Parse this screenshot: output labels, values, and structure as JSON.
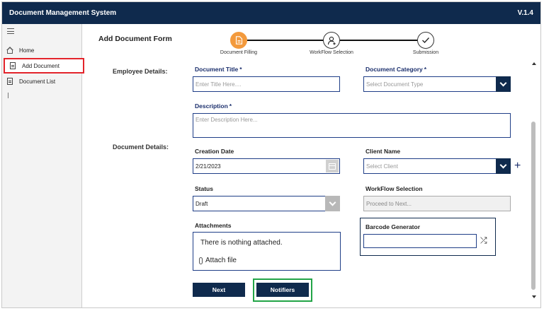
{
  "app": {
    "title": "Document Management System",
    "version": "V.1.4"
  },
  "sidebar": {
    "items": [
      {
        "label": "Home",
        "icon": "home-icon"
      },
      {
        "label": "Add Document",
        "icon": "document-icon"
      },
      {
        "label": "Document List",
        "icon": "document-list-icon"
      }
    ]
  },
  "form": {
    "title": "Add Document Form",
    "steps": [
      {
        "label": "Document Filling",
        "icon": "document-icon",
        "active": true
      },
      {
        "label": "WorkFlow Selection",
        "icon": "user-add-icon",
        "active": false
      },
      {
        "label": "Submission",
        "icon": "checkmark-icon",
        "active": false
      }
    ],
    "sections": {
      "employee": "Employee Details:",
      "document": "Document Details:"
    },
    "document_title": {
      "label": "Document Title",
      "required": "*",
      "placeholder": "Enter Title Here...."
    },
    "document_category": {
      "label": "Document Category",
      "required": "*",
      "placeholder": "Select Document Type"
    },
    "description": {
      "label": "Description",
      "required": "*",
      "placeholder": "Enter Description Here..."
    },
    "creation_date": {
      "label": "Creation Date",
      "value": "2/21/2023"
    },
    "client_name": {
      "label": "Client Name",
      "placeholder": "Select Client",
      "add": "+"
    },
    "status": {
      "label": "Status",
      "value": "Draft"
    },
    "workflow_selection": {
      "label": "WorkFlow Selection",
      "placeholder": "Proceed to Next..."
    },
    "attachments": {
      "label": "Attachments",
      "empty_text": "There is nothing attached.",
      "attach_label": "Attach file"
    },
    "barcode": {
      "label": "Barcode Generator",
      "value": ""
    },
    "buttons": {
      "next": "Next",
      "notifiers": "Notifiers"
    }
  },
  "colors": {
    "header": "#0f2a4d",
    "active_step": "#f39a3d",
    "sidebar_highlight": "#e3242b",
    "notifiers_highlight": "#22a447"
  }
}
